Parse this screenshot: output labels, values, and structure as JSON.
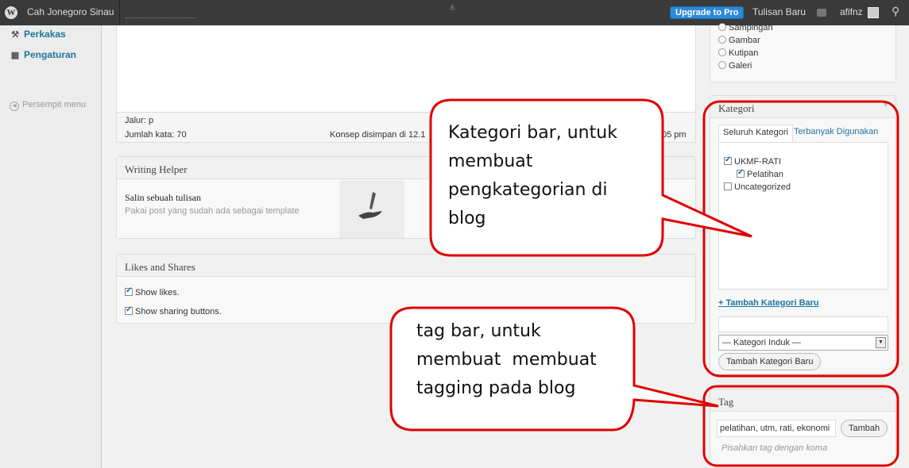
{
  "adminbar": {
    "logo_label": "W",
    "site_name": "Cah Jonegoro Sinau",
    "mid_icon": "≚",
    "upgrade_label": "Upgrade to Pro",
    "new_post_label": "Tulisan Baru",
    "user_name": "afifnz",
    "search_glyph": "⚲"
  },
  "sidebar": {
    "items": [
      {
        "icon": "tools-icon",
        "glyph": "⚒",
        "label": "Perkakas"
      },
      {
        "icon": "settings-icon",
        "glyph": "▦",
        "label": "Pengaturan"
      }
    ],
    "collapse_label": "Persempit menu",
    "collapse_glyph": "◀"
  },
  "editor": {
    "path_label": "Jalur:",
    "path_value": "p",
    "word_count": "Jumlah kata: 70",
    "draft_text": "Konsep disimpan di 12.1",
    "draft_time_tail": "05 pm"
  },
  "writing_helper": {
    "title": "Writing Helper",
    "item_title": "Salin sebuah tulisan",
    "item_subtitle": "Pakai post yang sudah ada sebagai template"
  },
  "likes_shares": {
    "title": "Likes and Shares",
    "show_likes": "Show likes.",
    "show_sharing": "Show sharing buttons."
  },
  "format": {
    "options": [
      "Sampingan",
      "Gambar",
      "Kutipan",
      "Galeri"
    ]
  },
  "kategori": {
    "title": "Kategori",
    "toggle_glyph": "▼",
    "tab_all": "Seluruh Kategori",
    "tab_popular": "Terbanyak Digunakan",
    "items": [
      {
        "label": "UKMF-RATI",
        "checked": true
      },
      {
        "label": "Pelatihan",
        "checked": true
      },
      {
        "label": "Uncategorized",
        "checked": false
      }
    ],
    "add_link": "+ Tambah Kategori Baru",
    "parent_select": "— Kategori Induk —",
    "select_arrow": "▼",
    "add_button": "Tambah Kategori Baru"
  },
  "tag": {
    "title": "Tag",
    "input_value": "pelatihan, utm, rati, ekonomi",
    "add_button": "Tambah",
    "hint": "Pisahkan tag dengan koma"
  },
  "callouts": {
    "kategori": [
      "Kategori bar, untuk",
      "membuat",
      "pengkategorian di",
      "blog"
    ],
    "tag": [
      "tag bar, untuk",
      "membuat  membuat",
      "tagging pada blog"
    ],
    "stroke_color": "#e00000"
  }
}
